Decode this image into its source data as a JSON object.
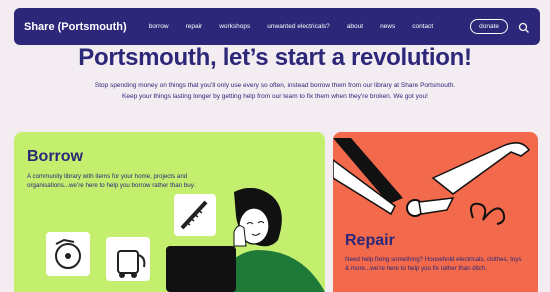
{
  "nav": {
    "logo": "Share (Portsmouth)",
    "links": [
      "borrow",
      "repair",
      "workshops",
      "unwanted electricals?",
      "about",
      "news",
      "contact"
    ],
    "donate": "donate",
    "search_icon": "search-icon"
  },
  "hero": {
    "title": "Portsmouth, let’s start a revolution!",
    "intro_line1": "Stop spending money on things that you’ll only use every so often, instead borrow them from our library at Share Portsmouth.",
    "intro_line2": "Keep your things lasting longer by getting help from our team to fix them when they’re broken. We got you!"
  },
  "cards": {
    "borrow": {
      "title": "Borrow",
      "text": "A community library with items for your home, projects and organisations...we’re here to help you borrow rather than buy.",
      "color": "#c4ee6e"
    },
    "repair": {
      "title": "Repair",
      "text": "Need help fixing something? Household electricals, clothes, toys & more...we’re here to help you fix rather than ditch.",
      "color": "#f26a4b"
    }
  },
  "colors": {
    "brand": "#2c2779",
    "background": "#f3ecf1"
  }
}
